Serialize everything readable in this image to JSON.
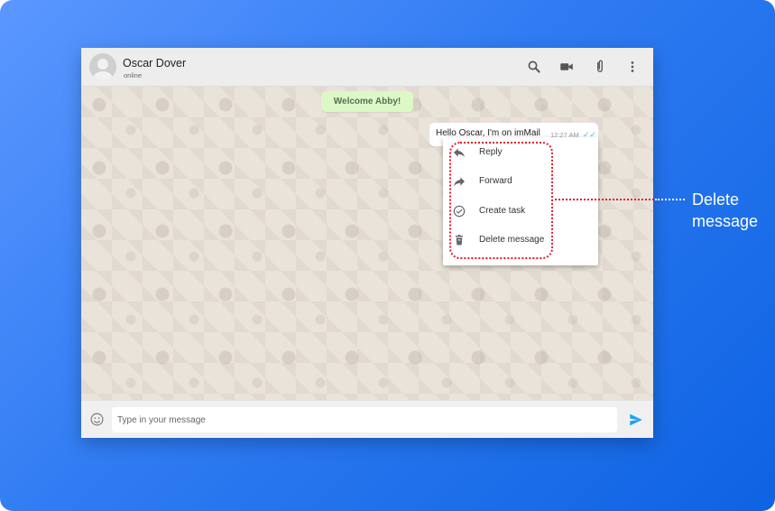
{
  "header": {
    "contact_name": "Oscar Dover",
    "status": "online",
    "icons": [
      "search-icon",
      "video-call-icon",
      "attachment-icon",
      "more-options-icon"
    ]
  },
  "chat": {
    "welcome_text": "Welcome Abby!",
    "message": {
      "text": "Hello Oscar, I'm on imMail",
      "time": "12:27 AM",
      "status_icon": "double-check-icon"
    }
  },
  "context_menu": {
    "items": [
      {
        "label": "Reply",
        "icon": "reply-icon"
      },
      {
        "label": "Forward",
        "icon": "forward-icon"
      },
      {
        "label": "Create task",
        "icon": "check-circle-icon"
      },
      {
        "label": "Delete message",
        "icon": "trash-icon"
      }
    ]
  },
  "callout": {
    "label": "Delete message"
  },
  "composer": {
    "placeholder": "Type in your message",
    "value": ""
  },
  "colors": {
    "background_start": "#5b97ff",
    "background_end": "#0e63e2",
    "highlight": "#e01b2a",
    "welcome_bg": "#dcf8c6",
    "send_icon": "#1da1f2",
    "check_icon": "#4fc3f7"
  }
}
